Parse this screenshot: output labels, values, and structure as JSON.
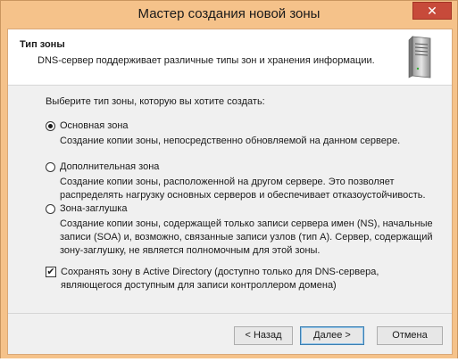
{
  "window": {
    "title": "Мастер создания новой зоны",
    "close_glyph": "✕"
  },
  "header": {
    "title": "Тип зоны",
    "description": "DNS-сервер поддерживает различные типы зон и хранения информации.",
    "icon": "server-icon"
  },
  "content": {
    "prompt": "Выберите тип зоны, которую вы хотите создать:",
    "options": [
      {
        "label": "Основная зона",
        "description": "Создание копии зоны, непосредственно обновляемой на данном сервере.",
        "selected": true
      },
      {
        "label": "Дополнительная зона",
        "description": "Создание копии зоны, расположенной на другом сервере. Это позволяет распределять нагрузку основных серверов и обеспечивает отказоустойчивость.",
        "selected": false
      },
      {
        "label": "Зона-заглушка",
        "description": "Создание копии зоны, содержащей только записи сервера имен (NS), начальные записи (SOA) и, возможно, связанные записи узлов (тип A). Сервер, содержащий зону-заглушку, не является полномочным для этой зоны.",
        "selected": false
      }
    ],
    "ad_checkbox": {
      "label": "Сохранять зону в Active Directory (доступно только для DNS-сервера, являющегося доступным для записи контроллером домена)",
      "checked": true
    }
  },
  "buttons": {
    "back": "< Назад",
    "next": "Далее >",
    "cancel": "Отмена"
  },
  "colors": {
    "titlebar": "#f5c28a",
    "close": "#c74a3a",
    "dialog_bg": "#f0f0f0",
    "default_button_border": "#3c7fb1"
  }
}
